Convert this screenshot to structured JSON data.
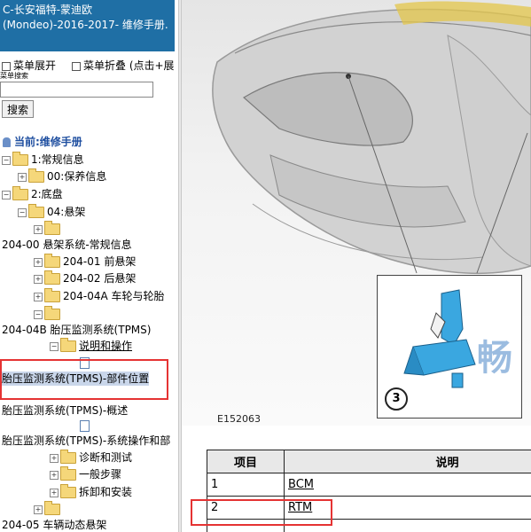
{
  "sidebar": {
    "title": "C-长安福特-蒙迪欧(Mondeo)-2016-2017- 维修手册.",
    "expand_all": "菜单展开",
    "collapse_all": "菜单折叠 (点击+展",
    "search_label": "菜单搜索",
    "search_value": "",
    "search_button": "搜索",
    "current": "当前:维修手册",
    "tree": [
      "1:常规信息",
      "00:保养信息",
      "2:底盘",
      "04:悬架",
      "204-00 悬架系统-常规信息",
      "204-01 前悬架",
      "204-02 后悬架",
      "204-04A 车轮与轮胎",
      "204-04B 胎压监测系统(TPMS)",
      "说明和操作",
      "胎压监测系统(TPMS)-部件位置",
      "胎压监测系统(TPMS)-概述",
      "胎压监测系统(TPMS)-系统操作和部",
      "诊断和测试",
      "一般步骤",
      "拆卸和安装",
      "204-05 车辆动态悬架"
    ]
  },
  "figure": {
    "code": "E152063",
    "callout": "3",
    "watermark": "畅"
  },
  "table": {
    "headers": [
      "项目",
      "说明"
    ],
    "rows": [
      [
        "1",
        "BCM"
      ],
      [
        "2",
        "RTM"
      ]
    ]
  },
  "colors": {
    "title_bg": "#1f6fa5",
    "highlight_border": "#e53333",
    "link": "#000000",
    "sensor": "#3aa7e0"
  }
}
